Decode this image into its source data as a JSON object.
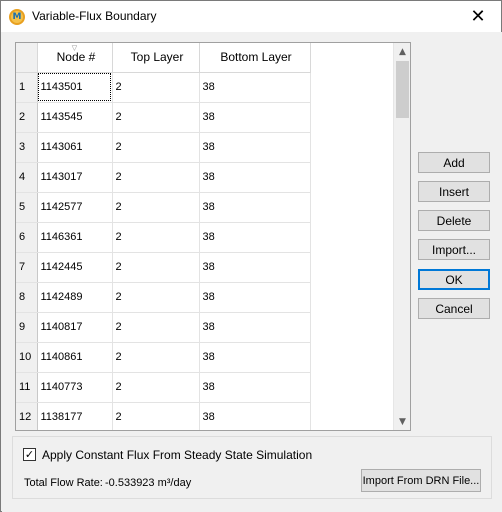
{
  "window": {
    "title": "Variable-Flux Boundary",
    "close_glyph": "✕",
    "app_icon_glyph": "M"
  },
  "table": {
    "columns": [
      "Node #",
      "Top Layer",
      "Bottom Layer"
    ],
    "rows": [
      {
        "index": "1",
        "node": "1143501",
        "top": "2",
        "bottom": "38"
      },
      {
        "index": "2",
        "node": "1143545",
        "top": "2",
        "bottom": "38"
      },
      {
        "index": "3",
        "node": "1143061",
        "top": "2",
        "bottom": "38"
      },
      {
        "index": "4",
        "node": "1143017",
        "top": "2",
        "bottom": "38"
      },
      {
        "index": "5",
        "node": "1142577",
        "top": "2",
        "bottom": "38"
      },
      {
        "index": "6",
        "node": "1146361",
        "top": "2",
        "bottom": "38"
      },
      {
        "index": "7",
        "node": "1142445",
        "top": "2",
        "bottom": "38"
      },
      {
        "index": "8",
        "node": "1142489",
        "top": "2",
        "bottom": "38"
      },
      {
        "index": "9",
        "node": "1140817",
        "top": "2",
        "bottom": "38"
      },
      {
        "index": "10",
        "node": "1140861",
        "top": "2",
        "bottom": "38"
      },
      {
        "index": "11",
        "node": "1140773",
        "top": "2",
        "bottom": "38"
      },
      {
        "index": "12",
        "node": "1138177",
        "top": "2",
        "bottom": "38"
      }
    ]
  },
  "buttons": {
    "add": "Add",
    "insert": "Insert",
    "delete": "Delete",
    "import": "Import...",
    "ok": "OK",
    "cancel": "Cancel"
  },
  "options": {
    "apply_constant_flux_label": "Apply Constant Flux From Steady State Simulation",
    "apply_constant_flux_checked": true,
    "check_glyph": "✓",
    "total_flow_label": "Total Flow Rate:",
    "total_flow_value": "-0.533923 m³/day",
    "import_drn_label": "Import From DRN File..."
  }
}
